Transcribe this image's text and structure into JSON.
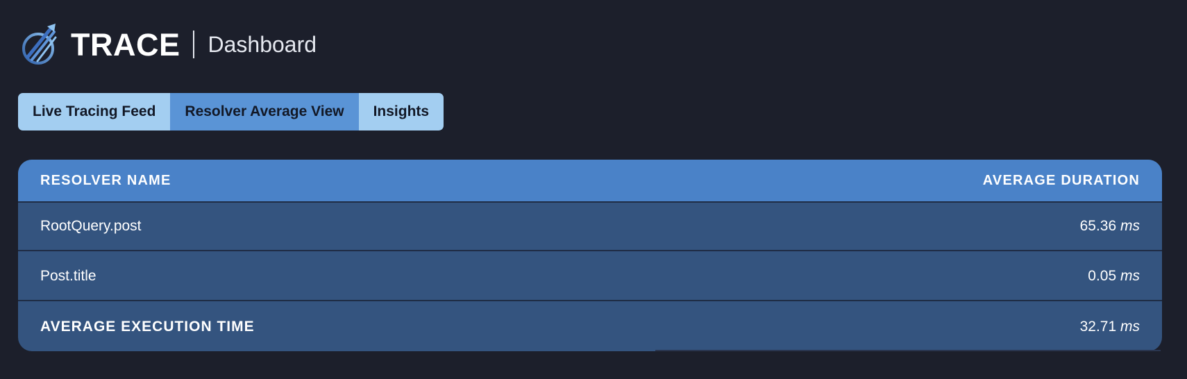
{
  "header": {
    "logo_icon": "trace-arrow-logo-icon",
    "brand": "TRACE",
    "subtitle": "Dashboard"
  },
  "tabs": [
    {
      "label": "Live Tracing Feed",
      "active": false
    },
    {
      "label": "Resolver Average View",
      "active": true
    },
    {
      "label": "Insights",
      "active": false
    }
  ],
  "table": {
    "columns": [
      "RESOLVER NAME",
      "AVERAGE DURATION"
    ],
    "rows": [
      {
        "name": "RootQuery.post",
        "value": "65.36",
        "unit": "ms"
      },
      {
        "name": "Post.title",
        "value": "0.05",
        "unit": "ms"
      }
    ],
    "footer": {
      "label": "AVERAGE EXECUTION TIME",
      "value": "32.71",
      "unit": "ms"
    }
  },
  "colors": {
    "background": "#1c1f2b",
    "tab_inactive": "#a3cef1",
    "tab_active": "#5a94d6",
    "table_header": "#4a82c8",
    "table_body": "#34547f"
  }
}
